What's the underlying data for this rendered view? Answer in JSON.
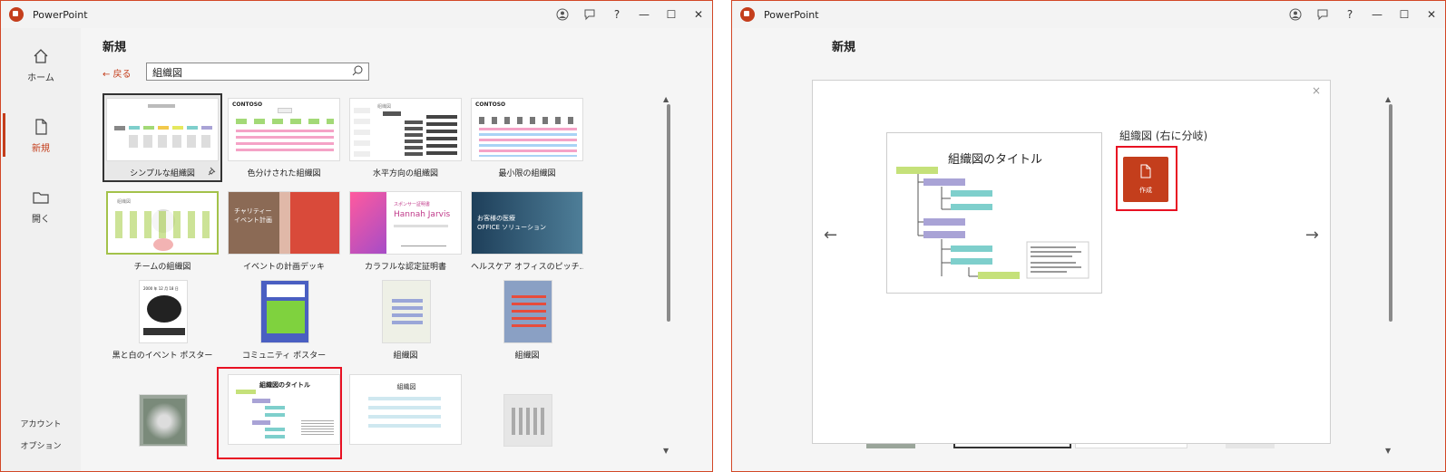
{
  "app": {
    "title": "PowerPoint"
  },
  "titlebar": {
    "help": "?",
    "minimize": "—",
    "maximize": "☐",
    "close": "✕"
  },
  "sidebar": {
    "home": "ホーム",
    "new": "新規",
    "open": "開く",
    "account": "アカウント",
    "options": "オプション"
  },
  "page": {
    "heading": "新規",
    "back_label": "← 戻る",
    "search_value": "組織図"
  },
  "templates": [
    {
      "name": "シンプルな組織図"
    },
    {
      "name": "色分けされた組織図"
    },
    {
      "name": "水平方向の組織図"
    },
    {
      "name": "最小限の組織図"
    },
    {
      "name": "チームの組織図"
    },
    {
      "name": "イベントの計画デッキ"
    },
    {
      "name": "カラフルな認定証明書"
    },
    {
      "name": "ヘルスケア オフィスのピッチ…"
    },
    {
      "name": "黒と白のイベント ポスター"
    },
    {
      "name": "コミュニティ ポスター"
    },
    {
      "name": "組織図"
    },
    {
      "name": "組織図"
    }
  ],
  "thumb_text": {
    "contoso1": "CONTOSO",
    "contoso2": "CONTOSO",
    "soshiki": "組織図",
    "event": "チャリティー\nイベント計画",
    "cert_small": "スポンサー証明書",
    "cert_name": "Hannah Jarvis",
    "health": "お客様の医療\nOFFICE ソリューション",
    "poster_date": "2000 年 12 月 18 日",
    "row4_title": "組織図のタイトル",
    "row4_b": "組織図"
  },
  "modal": {
    "preview_title": "組織図のタイトル",
    "template_title": "組織図 (右に分岐)",
    "create_label": "作成",
    "close": "×",
    "prev": "←",
    "next": "→"
  },
  "colors": {
    "accent": "#c43e1c",
    "highlight_red": "#e81123",
    "lime": "#c5e17a",
    "purple": "#a9a3d6",
    "teal": "#7ecfcc"
  }
}
